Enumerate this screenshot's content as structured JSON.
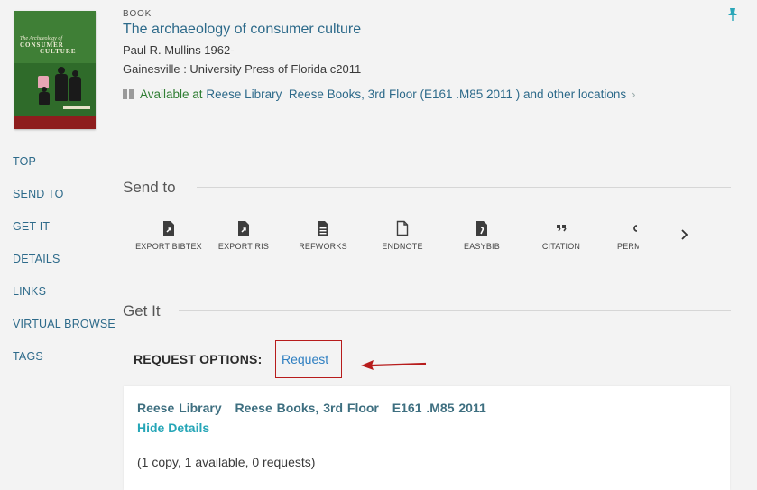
{
  "record": {
    "type": "BOOK",
    "title": "The archaeology of consumer culture",
    "author": "Paul R. Mullins 1962-",
    "publisher": "Gainesville : University Press of Florida c2011",
    "availability": {
      "status_text": "Available at",
      "library": "Reese Library",
      "location": "Reese Books, 3rd Floor (E161 .M85 2011 ) and other locations"
    },
    "cover": {
      "title_line1": "The Archaeology of",
      "title_line2": "CONSUMER",
      "title_line3": "CULTURE",
      "author": "Paul R. Mullins"
    }
  },
  "nav": {
    "items": [
      "TOP",
      "SEND TO",
      "GET IT",
      "DETAILS",
      "LINKS",
      "VIRTUAL BROWSE",
      "TAGS"
    ]
  },
  "send_to": {
    "title": "Send to",
    "items": [
      {
        "label": "EXPORT BIBTEX",
        "icon": "export-file-icon"
      },
      {
        "label": "EXPORT RIS",
        "icon": "export-file-icon"
      },
      {
        "label": "REFWORKS",
        "icon": "document-lines-icon"
      },
      {
        "label": "ENDNOTE",
        "icon": "blank-document-icon"
      },
      {
        "label": "EASYBIB",
        "icon": "easybib-icon"
      },
      {
        "label": "CITATION",
        "icon": "quote-icon"
      },
      {
        "label": "PERM",
        "icon": "link-icon"
      }
    ]
  },
  "get_it": {
    "title": "Get It",
    "request_options_label": "REQUEST OPTIONS:",
    "request_link": "Request",
    "location": {
      "library": "Reese Library",
      "sublocation": "Reese Books, 3rd Floor",
      "call_number": "E161 .M85 2011",
      "toggle": "Hide Details",
      "summary": "(1 copy, 1 available, 0 requests)"
    }
  },
  "colors": {
    "link": "#2d6a8a",
    "available": "#2e7d32",
    "highlight_box": "#b71c1c",
    "detail_link": "#26a6b7"
  }
}
